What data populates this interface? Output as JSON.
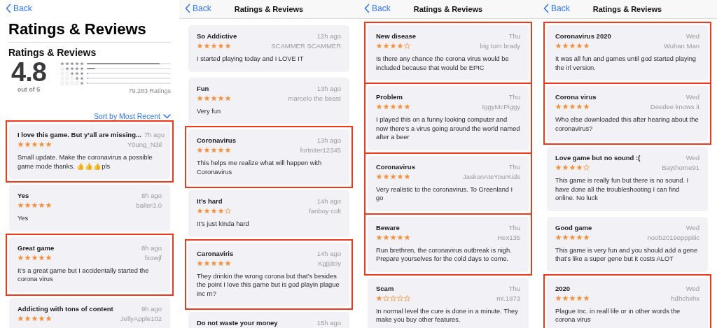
{
  "panels": [
    {
      "kind": "summary",
      "back": "Back",
      "title": "Ratings & Reviews",
      "section_title": "Ratings & Reviews",
      "score": "4.8",
      "score_caption": "out of 5",
      "histogram": [
        {
          "stars": 5,
          "level": 0.87
        },
        {
          "stars": 4,
          "level": 0.1
        },
        {
          "stars": 3,
          "level": 0.02
        },
        {
          "stars": 2,
          "level": 0.01
        },
        {
          "stars": 1,
          "level": 0.01
        }
      ],
      "ratings_count": "79.283 Ratings",
      "sort_label": "Sort by Most Recent",
      "reviews": [
        {
          "title": "I love this game. But y’all are missing...",
          "time": "7h ago",
          "author": "Y0ung_N3il",
          "stars": 5,
          "body": "Small update. Make the coronavirus a possible game mode thanks. 👍👍👍pls",
          "highlighted": true
        },
        {
          "title": "Yes",
          "time": "8h ago",
          "author": "baller3.0",
          "stars": 5,
          "body": "Yes",
          "highlighted": false
        },
        {
          "title": "Great game",
          "time": "8h ago",
          "author": "fxowjf",
          "stars": 5,
          "body": "It’s a great game but I accidentally started the corona virus",
          "highlighted": true
        },
        {
          "title": "Addicting with tons of content",
          "time": "9h ago",
          "author": "JellyApple102",
          "stars": 5,
          "highlighted": false
        }
      ]
    },
    {
      "kind": "list",
      "back": "Back",
      "title": "Ratings & Reviews",
      "reviews": [
        {
          "title": "So Addictive",
          "time": "12h ago",
          "author": "SCAMMER SCAMMER",
          "stars": 5,
          "body": "I started playing today and I LOVE IT",
          "highlighted": false
        },
        {
          "title": "Fun",
          "time": "13h ago",
          "author": "marcelo the beast",
          "stars": 5,
          "body": "Very fun",
          "highlighted": false
        },
        {
          "title": "Coronavirus",
          "time": "13h ago",
          "author": "fortniter12345",
          "stars": 5,
          "body": "This helps me realize what will happen with Coronavirus",
          "highlighted": true
        },
        {
          "title": "It’s hard",
          "time": "14h ago",
          "author": "fanboy colt",
          "stars": 4,
          "body": "It’s just kinda hard",
          "highlighted": false
        },
        {
          "title": "Caronaviris",
          "time": "14h ago",
          "author": "Kgjjdciy",
          "stars": 5,
          "body": "They drinkin the wrong corona but that’s besides the point I love this game but is god playin plague inc rn?",
          "highlighted": true
        },
        {
          "title": "Do not waste your money",
          "time": "15h ago",
          "highlighted": false
        }
      ]
    },
    {
      "kind": "list",
      "back": "Back",
      "title": "Ratings & Reviews",
      "reviews": [
        {
          "title": "New disease",
          "time": "Thu",
          "author": "big tom brady",
          "stars": 4,
          "body": "Is there any chance the corona virus would be included because that would be EPIC",
          "highlighted": true
        },
        {
          "title": "Problem",
          "time": "Thu",
          "author": "IggyMcPiggy",
          "stars": 5,
          "body": "I played this on a funny looking computer and now there’s a virus going around the world named after a beer",
          "highlighted": true
        },
        {
          "title": "Coronavirus",
          "time": "Thu",
          "author": "JaskonAteYourKids",
          "stars": 5,
          "body": "Very realistic to the coronavirus. To Greenland I go",
          "highlighted": true
        },
        {
          "title": "Beware",
          "time": "Thu",
          "author": "Hex135",
          "stars": 5,
          "body": "Run brethren, the coronavirus outbreak is nigh. Prepare yourselves for the cold days to come.",
          "highlighted": true
        },
        {
          "title": "Scam",
          "time": "Thu",
          "author": "mi.1873",
          "stars": 1,
          "body": "In normal level the cure is done in a minute. They make you buy other features.",
          "highlighted": false
        }
      ]
    },
    {
      "kind": "list",
      "back": "Back",
      "title": "Ratings & Reviews",
      "reviews": [
        {
          "title": "Coronavirus 2020",
          "time": "Wed",
          "author": "Wuhan Man",
          "stars": 5,
          "body": "It was all fun and games until god started playing the irl version.",
          "highlighted": true
        },
        {
          "title": "Corona virus",
          "time": "Wed",
          "author": "Deedee knows it",
          "stars": 5,
          "body": "Who else downloaded this after hearing about the coronavirus?",
          "highlighted": true
        },
        {
          "title": "Love game but no sound :(",
          "time": "Wed",
          "author": "Baythorne91",
          "stars": 4,
          "body": "This game is really fun but there is no sound. I have done all the troubleshooting I can find online. No luck",
          "highlighted": false
        },
        {
          "title": "Good game",
          "time": "Wed",
          "author": "noob2019epppiiic",
          "stars": 5,
          "body": "This game is very fun and you should add a gene that’s like a super gene but it costs ALOT",
          "highlighted": false
        },
        {
          "title": "2020",
          "time": "Wed",
          "author": "hdhchxhx",
          "stars": 5,
          "body": "Plague Inc. in reall life or in other words the corona virus",
          "highlighted": true
        }
      ]
    }
  ]
}
